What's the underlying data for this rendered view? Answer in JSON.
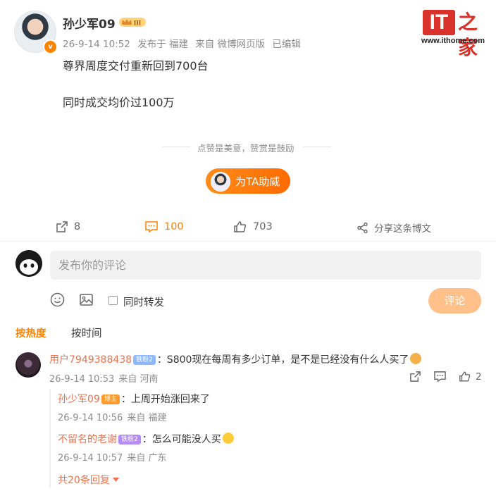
{
  "post": {
    "author": "孙少军09",
    "meta": {
      "time": "26-9-14 10:52",
      "location": "发布于 福建",
      "source": "来自 微博网页版",
      "edited": "已编辑"
    },
    "lines": [
      "尊界周度交付重新回到700台",
      "同时成交均价过100万"
    ],
    "tip_text": "点赞是美意，赞赏是鼓励",
    "support_button": "为TA助威"
  },
  "logo": {
    "brand": "IT",
    "zh": "之家",
    "url": "www.ithome.com"
  },
  "actions": {
    "forward_count": "8",
    "comment_count": "100",
    "like_count": "703",
    "share_label": "分享这条博文"
  },
  "compose": {
    "placeholder": "发布你的评论",
    "repost_label": "同时转发",
    "submit_label": "评论"
  },
  "sort_tabs": {
    "hot": "按热度",
    "time": "按时间"
  },
  "comments": [
    {
      "user": "用户7949388438",
      "badge": "铁粉2",
      "text": "：S800现在每周有多少订单，是不是已经没有什么人买了",
      "time": "26-9-14 10:53",
      "location": "来自 河南",
      "like_count": "2",
      "replies": [
        {
          "user": "孙少军09",
          "badge": "博主",
          "text": "：上周开始涨回来了",
          "time": "26-9-14 10:56",
          "location": "来自 福建"
        },
        {
          "user": "不留名的老谢",
          "badge": "铁粉2",
          "text": "：怎么可能没人买",
          "time": "26-9-14 10:57",
          "location": "来自 广东"
        }
      ],
      "more_label": "共20条回复"
    }
  ],
  "colors": {
    "accent": "#ff8200",
    "username": "#eb7350",
    "logo_red": "#d8322b"
  }
}
